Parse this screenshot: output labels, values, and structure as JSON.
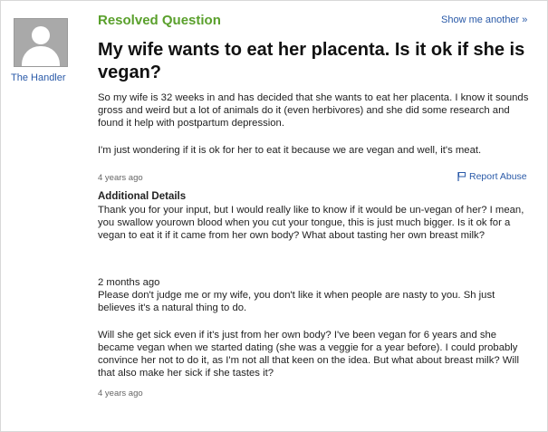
{
  "user": {
    "name": "The Handler",
    "avatar_icon": "default-user-avatar-icon"
  },
  "question": {
    "status": "Resolved Question",
    "show_another": "Show me another »",
    "title": "My wife wants to eat her placenta. Is it ok if she is vegan?",
    "body_p1": "So my wife is 32 weeks in and has decided that she wants to eat her placenta. I know it sounds gross and weird but a lot of animals do it (even herbivores) and she did some research and found it help with postpartum depression.",
    "body_p2": "I'm just wondering if it is ok for her to eat it because we are vegan and well, it's meat.",
    "asked_time": "4 years ago",
    "report_abuse": "Report Abuse",
    "report_icon": "flag-icon"
  },
  "additional_details": {
    "heading": "Additional Details",
    "detail1": "Thank you for your input, but I would really like to know if it would be un-vegan of her? I mean, you swallow yourown blood when you cut your tongue, this is just much bigger. Is it ok for a vegan to eat it if it came from her own body? What about tasting her own breast milk?",
    "detail2_time": "2 months ago",
    "detail2": "Please don't judge me or my wife, you don't like it when people are nasty to you. Sh just believes it's a natural thing to do.",
    "detail3": "Will she get sick even if it's just from her own body? I've been vegan for 6 years and she became vegan when we started dating (she was a veggie for a year before). I could probably convince her not to do it, as I'm not all that keen on the idea. But what about breast milk? Will that also make her sick if she tastes it?",
    "detail3_time": "4 years ago"
  },
  "colors": {
    "link": "#2a5aa8",
    "resolved": "#5aa02c"
  }
}
